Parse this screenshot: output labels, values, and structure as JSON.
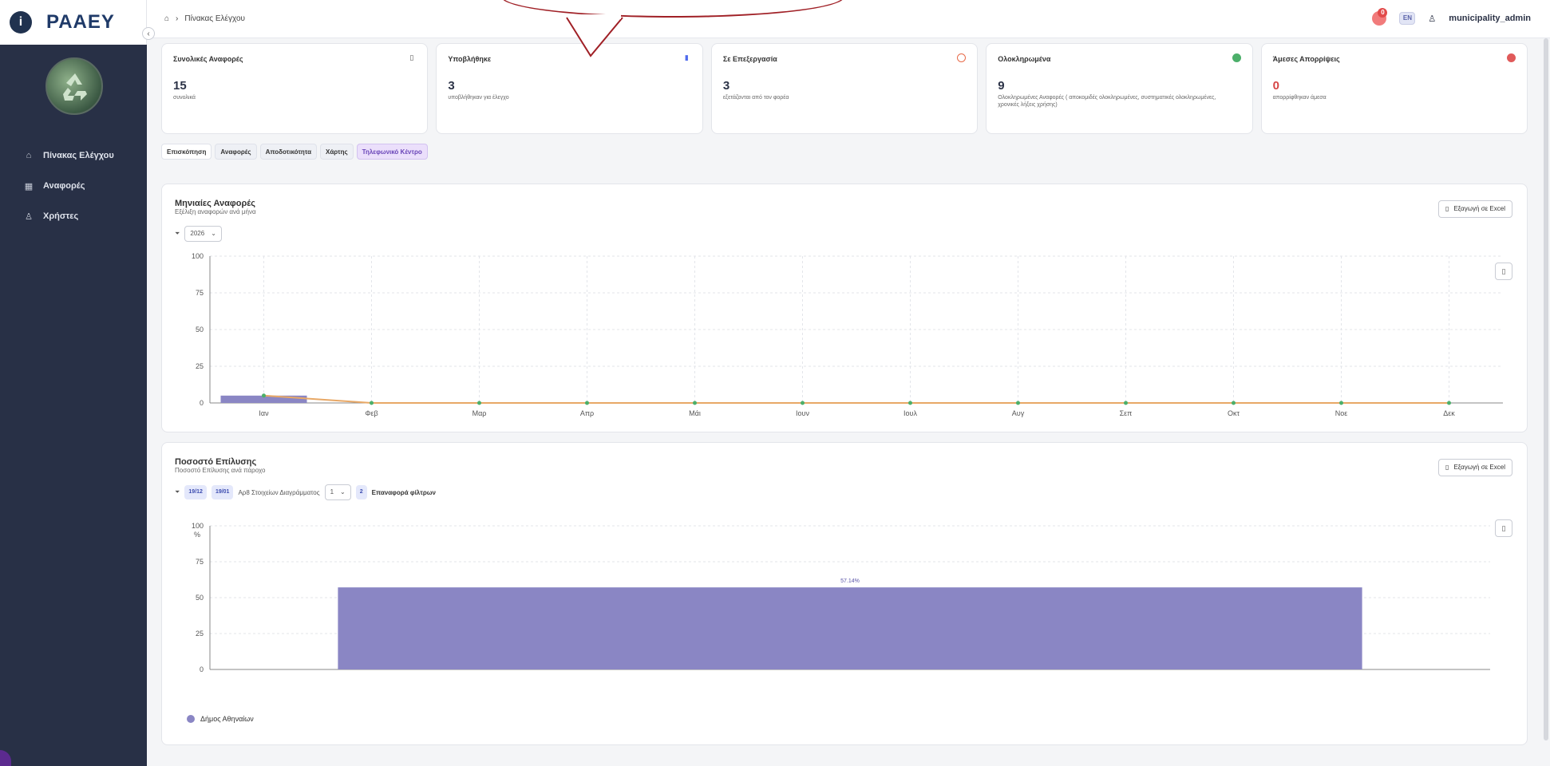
{
  "brand": {
    "logo_text": "ΡΑΑΕΥ",
    "logo_mark": "i"
  },
  "sidebar": {
    "items": [
      {
        "label": "Πίνακας Ελέγχου",
        "icon": "home-icon"
      },
      {
        "label": "Αναφορές",
        "icon": "grid-icon"
      },
      {
        "label": "Χρήστες",
        "icon": "users-icon"
      }
    ]
  },
  "header": {
    "breadcrumb": [
      "Πίνακας Ελέγχου"
    ],
    "notification_count": "0",
    "language": "EN",
    "user": "municipality_admin"
  },
  "stats": [
    {
      "title": "Συνολικές Αναφορές",
      "value": "15",
      "desc": "συνολικά",
      "color": "#555555"
    },
    {
      "title": "Υποβλήθηκε",
      "value": "3",
      "desc": "υποβλήθηκαν για έλεγχο",
      "color": "#4f6bed"
    },
    {
      "title": "Σε Επεξεργασία",
      "value": "3",
      "desc": "εξετάζονται από τον φορέα",
      "color": "#e86b4a"
    },
    {
      "title": "Ολοκληρωμένα",
      "value": "9",
      "desc": "Ολοκληρωμένες Αναφορές ( αποκομιδές ολοκληρωμένες, συστηματικές ολοκληρωμένες, χρονικές λήξεις χρήσης)",
      "color": "#4caf6a"
    },
    {
      "title": "Άμεσες Απορρίψεις",
      "value": "0",
      "desc": "απορρίφθηκαν άμεσα",
      "color": "#e05a5a"
    }
  ],
  "tabs": [
    "Επισκόπηση",
    "Αναφορές",
    "Αποδοτικότητα",
    "Χάρτης",
    "Τηλεφωνικό Κέντρο"
  ],
  "monthly_panel": {
    "title": "Μηνιαίες Αναφορές",
    "subtitle": "Εξέλιξη αναφορών ανά μήνα",
    "export_label": "Εξαγωγή σε Excel",
    "year": "2026"
  },
  "resolution_panel": {
    "title": "Ποσοστό Επίλυσης",
    "subtitle": "Ποσοστό Επίλυσης ανά πάροχο",
    "export_label": "Εξαγωγή σε Excel",
    "date_from": "19/12",
    "date_to": "19/01",
    "interval_label": "Αρ8 Στοιχείων Διαγράμματος",
    "interval_value": "1",
    "page": "2",
    "reset_label": "Επαναφορά φίλτρων"
  },
  "chart_data": [
    {
      "type": "line",
      "categories": [
        "Ιαν",
        "Φεβ",
        "Μαρ",
        "Απρ",
        "Μάι",
        "Ιουν",
        "Ιουλ",
        "Αυγ",
        "Σεπ",
        "Οκτ",
        "Νοε",
        "Δεκ"
      ],
      "series": [
        {
          "values": [
            5,
            0,
            0,
            0,
            0,
            0,
            0,
            0,
            0,
            0,
            0,
            0
          ],
          "color": "#e8a866",
          "kind": "line"
        },
        {
          "values": [
            5,
            0,
            0,
            0,
            0,
            0,
            0,
            0,
            0,
            0,
            0,
            0
          ],
          "color": "#8a86c4",
          "kind": "bar"
        }
      ],
      "ylim": [
        0,
        100
      ],
      "yticks": [
        "0",
        "25",
        "50",
        "75",
        "100"
      ],
      "grid": true
    },
    {
      "type": "bar",
      "categories": [
        "Δήμος Αθηναίων"
      ],
      "series": [
        {
          "name": "Δήμος Αθηναίων",
          "values": [
            57.14
          ],
          "color": "#8a86c4"
        }
      ],
      "data_labels": [
        "57.14%"
      ],
      "ylabel": "%",
      "ylim": [
        0,
        100
      ],
      "yticks": [
        "0",
        "25",
        "50",
        "75",
        "100"
      ],
      "legend": "bottom-left",
      "grid": true
    }
  ]
}
